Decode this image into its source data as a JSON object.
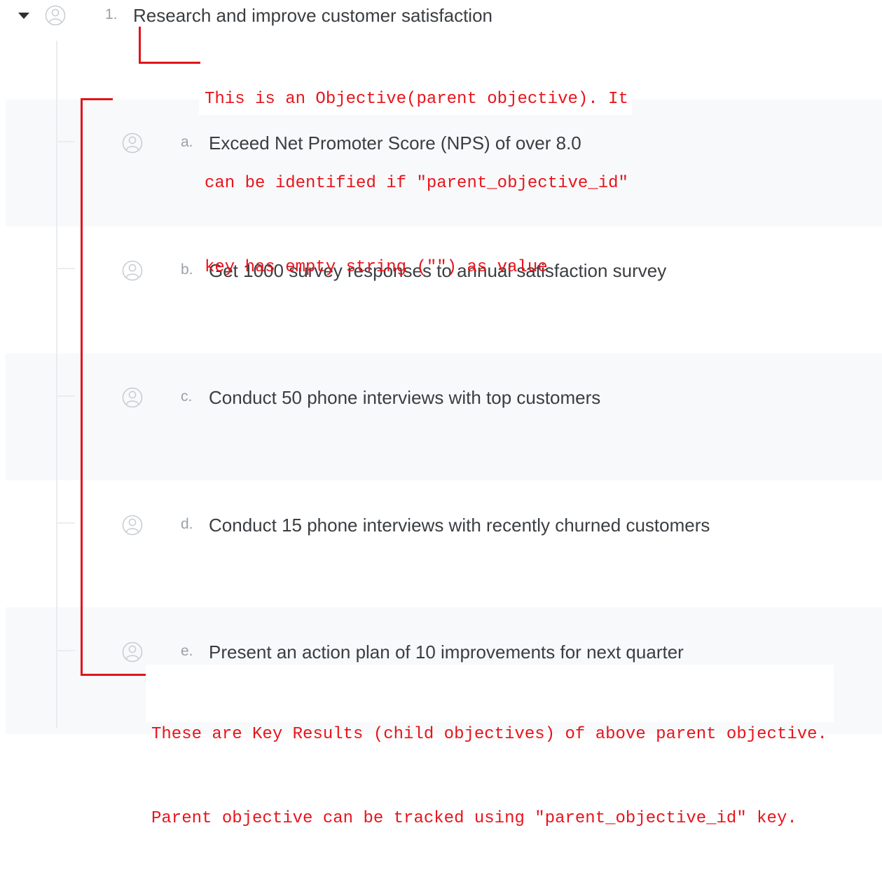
{
  "objective": {
    "index": "1.",
    "title": "Research and improve customer satisfaction"
  },
  "key_results": [
    {
      "index": "a.",
      "title": "Exceed Net Promoter Score (NPS) of over 8.0"
    },
    {
      "index": "b.",
      "title": "Get 1000 survey responses to annual satisfaction survey"
    },
    {
      "index": "c.",
      "title": "Conduct 50 phone interviews with top customers"
    },
    {
      "index": "d.",
      "title": "Conduct 15 phone interviews with recently churned customers"
    },
    {
      "index": "e.",
      "title": "Present an action plan of 10 improvements for next quarter"
    }
  ],
  "annotations": {
    "objective_note": [
      "This is an Objective(parent objective). It",
      "can be identified if \"parent_objective_id\"",
      "key has empty string (\"\") as value"
    ],
    "key_results_note": [
      "These are Key Results (child objectives) of above parent objective.",
      "Parent objective can be tracked using \"parent_objective_id\" key."
    ]
  },
  "colors": {
    "annotation": "#e0151b",
    "band": "#f7f9fa",
    "text": "#3a3e42",
    "index": "#9aa1a8"
  },
  "icons": {
    "expand": "caret-down-icon",
    "assignee": "user-avatar-icon"
  }
}
